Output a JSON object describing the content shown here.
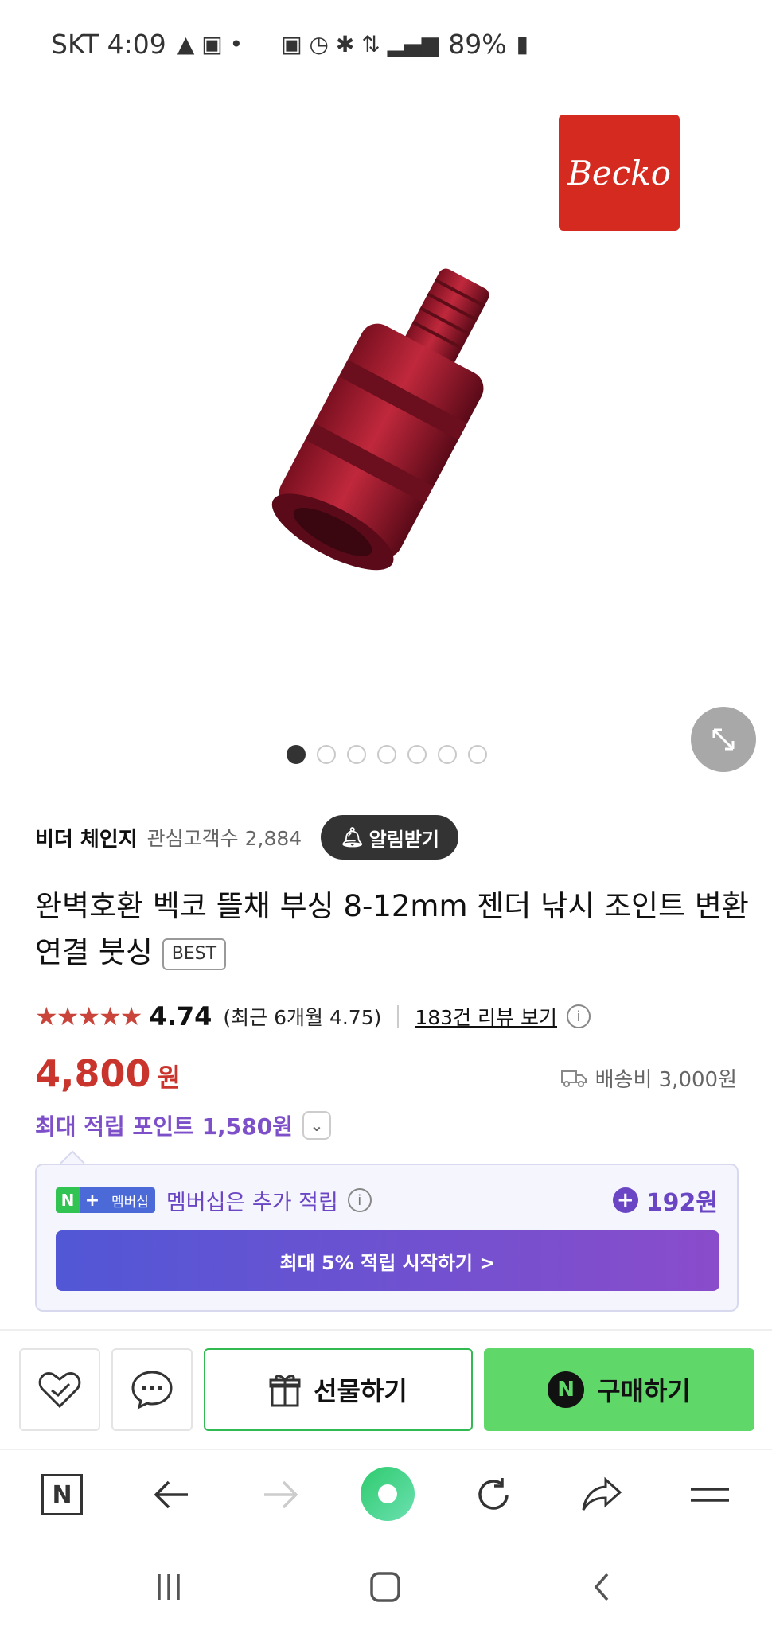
{
  "status_bar": {
    "carrier_time": "SKT 4:09",
    "battery": "89%"
  },
  "hero": {
    "brand_logo_text": "Becko",
    "image_count": 7,
    "active_image": 1
  },
  "seller": {
    "name": "비더 체인지",
    "fans_label": "관심고객수 2,884",
    "alarm_label": "알림받기"
  },
  "product": {
    "title": "완벽호환 벡코 뜰채 부싱 8-12mm 젠더 낚시 조인트 변환 연결 붓싱",
    "badge": "BEST",
    "rating_stars": 5,
    "rating": "4.74",
    "recent_rating": "(최근 6개월 4.75)",
    "review_link": "183건 리뷰 보기",
    "info_icon": "i",
    "price": "4,800",
    "price_unit": "원",
    "shipping": "배송비 3,000원",
    "max_points": "최대 적립 포인트 1,580원"
  },
  "membership": {
    "badge_n": "N",
    "badge_plus": "+",
    "badge_label": "멤버십",
    "text": "멤버십은 추가 적립",
    "points": "192원",
    "cta": "최대 5% 적립 시작하기 >"
  },
  "actions": {
    "gift_label": "선물하기",
    "buy_label": "구매하기",
    "buy_icon": "N"
  },
  "browser": {
    "home_icon": "N"
  },
  "colors": {
    "price_red": "#c9352c",
    "points_purple": "#7d4fc8",
    "buy_green": "#5fd769",
    "logo_red": "#d42a1f"
  }
}
